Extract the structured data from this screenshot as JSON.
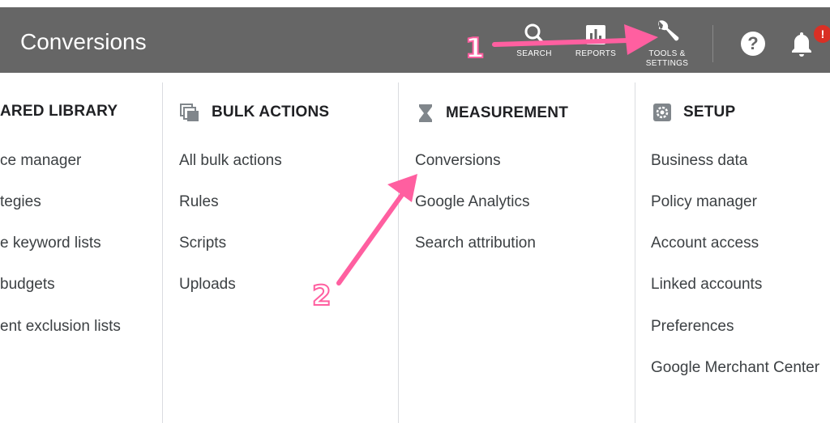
{
  "header": {
    "title": "Conversions",
    "tools": {
      "search": "SEARCH",
      "reports": "REPORTS",
      "tools_line1": "TOOLS &",
      "tools_line2": "SETTINGS"
    },
    "help_icon": "help-icon",
    "notification_badge": "!"
  },
  "columns": [
    {
      "heading": "ARED LIBRARY",
      "items": [
        "ce manager",
        "tegies",
        "e keyword lists",
        "budgets",
        "ent exclusion lists"
      ]
    },
    {
      "heading": "BULK ACTIONS",
      "icon": "bulk-actions-icon",
      "items": [
        "All bulk actions",
        "Rules",
        "Scripts",
        "Uploads"
      ]
    },
    {
      "heading": "MEASUREMENT",
      "icon": "hourglass-icon",
      "items": [
        "Conversions",
        "Google Analytics",
        "Search attribution"
      ]
    },
    {
      "heading": "SETUP",
      "icon": "gear-icon",
      "items": [
        "Business data",
        "Policy manager",
        "Account access",
        "Linked accounts",
        "Preferences",
        "Google Merchant Center"
      ]
    }
  ],
  "annotations": {
    "step1": "1",
    "step2": "2",
    "arrow_color": "#ff5fa0"
  },
  "colors": {
    "topbar": "#666666",
    "accent_arrow": "#ff5fa0",
    "badge": "#d93025"
  }
}
